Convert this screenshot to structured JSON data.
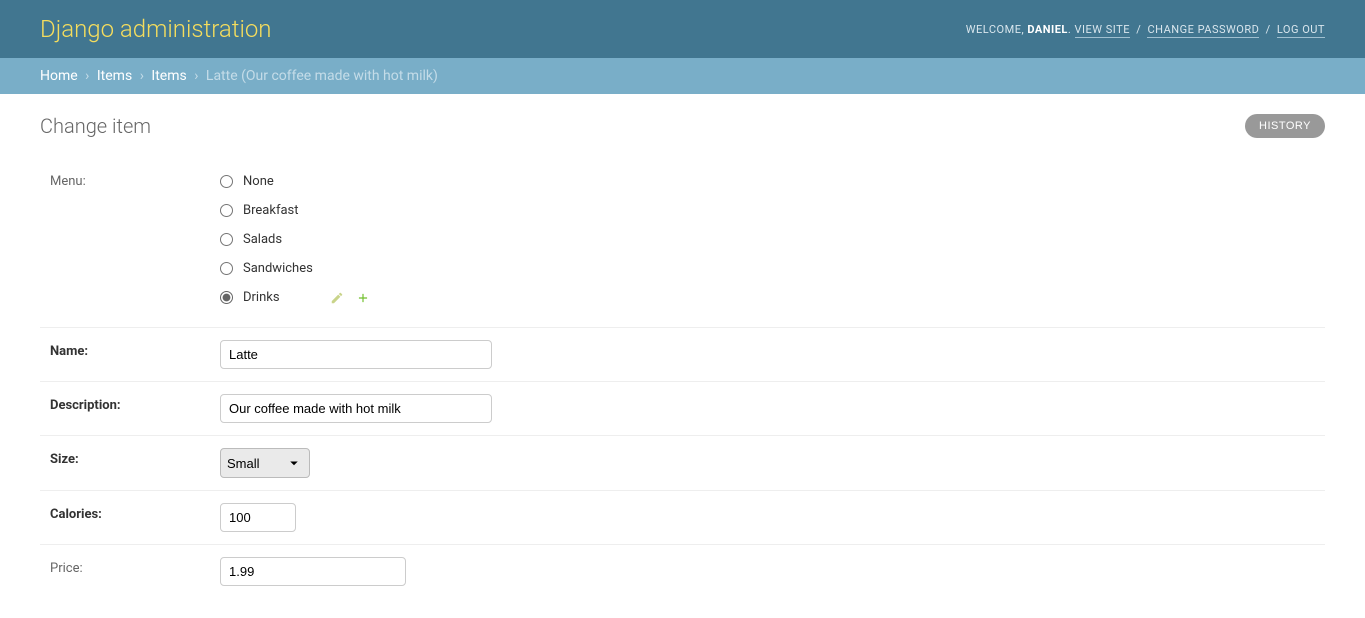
{
  "header": {
    "site_title": "Django administration",
    "welcome": "WELCOME, ",
    "username": "DANIEL",
    "view_site": "VIEW SITE",
    "change_password": "CHANGE PASSWORD",
    "log_out": "LOG OUT"
  },
  "breadcrumbs": {
    "home": "Home",
    "app": "Items",
    "model": "Items",
    "object": "Latte (Our coffee made with hot milk)"
  },
  "page": {
    "title": "Change item",
    "history": "HISTORY"
  },
  "form": {
    "menu": {
      "label": "Menu:",
      "options": [
        "None",
        "Breakfast",
        "Salads",
        "Sandwiches",
        "Drinks"
      ],
      "selected": "Drinks"
    },
    "name": {
      "label": "Name:",
      "value": "Latte"
    },
    "description": {
      "label": "Description:",
      "value": "Our coffee made with hot milk"
    },
    "size": {
      "label": "Size:",
      "value": "Small"
    },
    "calories": {
      "label": "Calories:",
      "value": "100"
    },
    "price": {
      "label": "Price:",
      "value": "1.99"
    }
  },
  "icons": {
    "edit": "edit-icon",
    "add": "add-icon"
  }
}
